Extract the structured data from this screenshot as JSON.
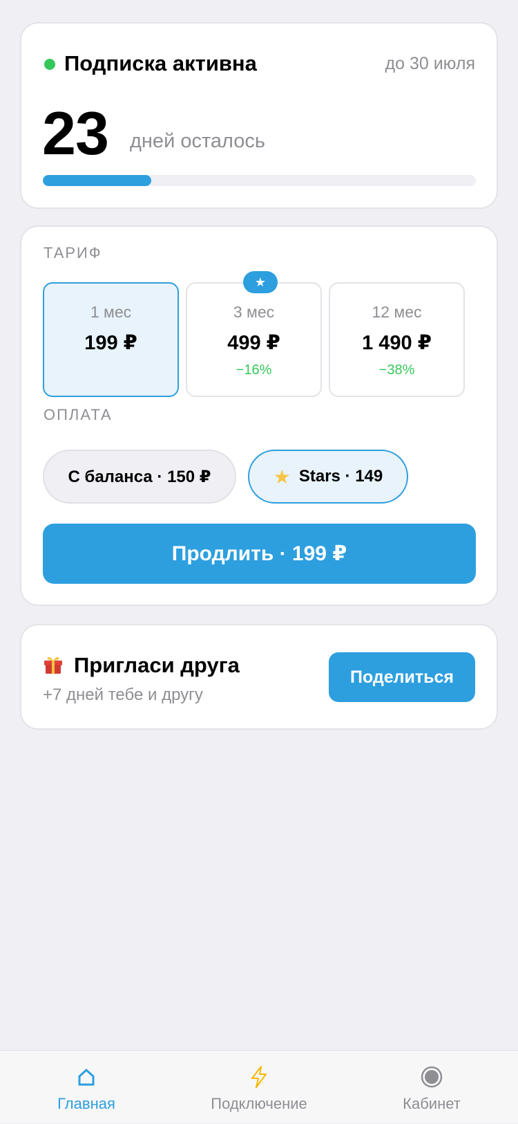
{
  "status": {
    "title": "Подписка активна",
    "until": "до 30 июля",
    "days_left": "23",
    "days_label": "дней осталось",
    "progress_fraction": 0.25,
    "dot_color": "#34c759"
  },
  "tariff": {
    "section_label": "ТАРИФ",
    "badge_icon": "star-icon",
    "plans": [
      {
        "period": "1 мес",
        "price": "199 ₽",
        "discount": "",
        "selected": true
      },
      {
        "period": "3 мес",
        "price": "499 ₽",
        "discount": "−16%",
        "selected": false
      },
      {
        "period": "12 мес",
        "price": "1 490 ₽",
        "discount": "−38%",
        "selected": false
      }
    ]
  },
  "payment": {
    "section_label": "ОПЛАТА",
    "balance_label": "С баланса · 150 ₽",
    "stars_label": "Stars · 149",
    "selected": "stars"
  },
  "renew_button": "Продлить · 199 ₽",
  "invite": {
    "title": "Пригласи друга",
    "subtitle": "+7 дней тебе и другу",
    "share_button": "Поделиться"
  },
  "tabbar": {
    "items": [
      {
        "label": "Главная",
        "icon": "home-icon",
        "active": true
      },
      {
        "label": "Подключение",
        "icon": "lightning-icon",
        "active": false
      },
      {
        "label": "Кабинет",
        "icon": "account-icon",
        "active": false
      }
    ]
  },
  "colors": {
    "accent": "#2d9fdf",
    "success": "#34c759",
    "secondary_text": "#8e8e93",
    "background": "#efeff4"
  }
}
